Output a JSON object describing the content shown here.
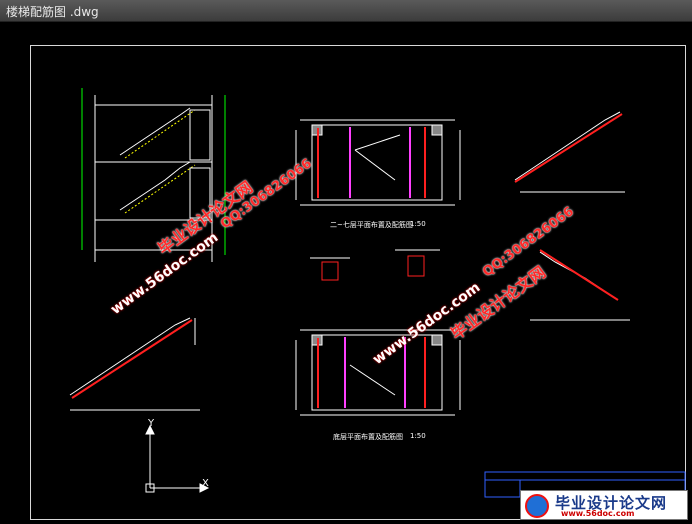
{
  "window": {
    "title": "楼梯配筋图 .dwg"
  },
  "axes": {
    "x_label": "X",
    "y_label": "Y"
  },
  "watermarks": {
    "site_url": "www.56doc.com",
    "qq": "QQ:306826066",
    "brand": "毕业设计论文网"
  },
  "drawing_labels": {
    "plan_upper": "二~七层平面布置及配筋图",
    "plan_upper_scale": "1:50",
    "plan_ground": "底层平面布置及配筋图",
    "plan_ground_scale": "1:50"
  },
  "brand_box": {
    "name": "毕业设计论文网",
    "url": "www.56doc.com"
  },
  "colors": {
    "background": "#000000",
    "line_white": "#ffffff",
    "line_green": "#00ff00",
    "line_red": "#ff2020",
    "line_magenta": "#ff40ff",
    "line_cyan": "#00ffff",
    "title_block_blue": "#3060ff"
  }
}
